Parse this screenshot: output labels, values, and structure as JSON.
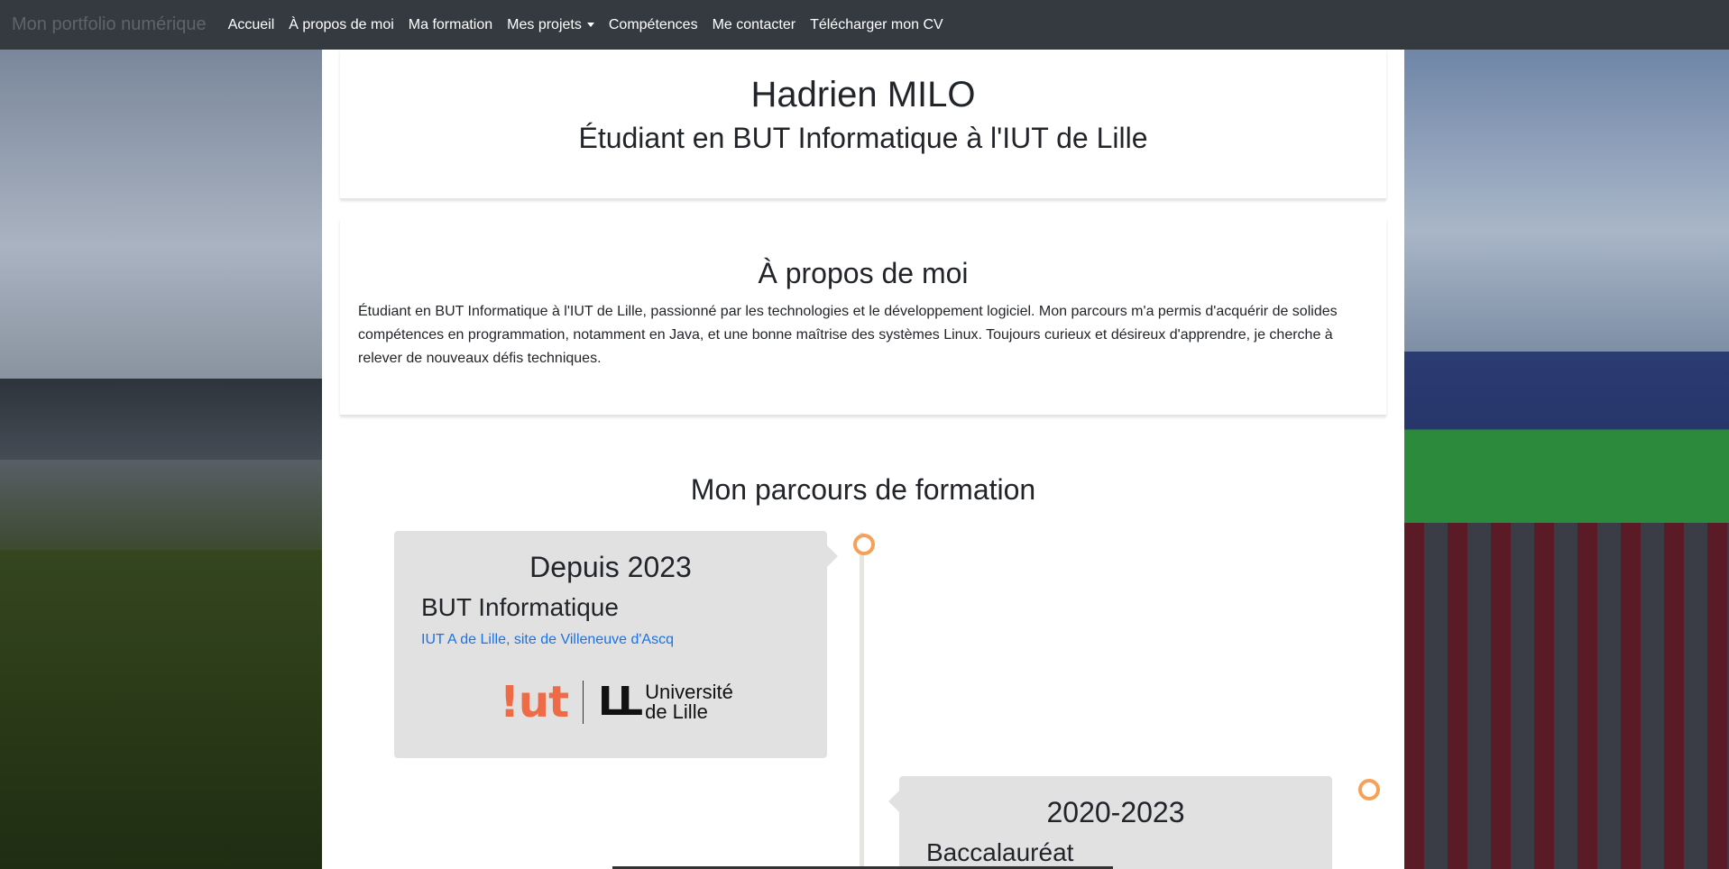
{
  "navbar": {
    "brand": "Mon portfolio numérique",
    "items": [
      {
        "label": "Accueil"
      },
      {
        "label": "À propos de moi"
      },
      {
        "label": "Ma formation"
      },
      {
        "label": "Mes projets",
        "dropdown": true
      },
      {
        "label": "Compétences"
      },
      {
        "label": "Me contacter"
      },
      {
        "label": "Télécharger mon CV"
      }
    ]
  },
  "header": {
    "name": "Hadrien MILO",
    "subtitle": "Étudiant en BUT Informatique à l'IUT de Lille"
  },
  "about": {
    "title": "À propos de moi",
    "text": "Étudiant en BUT Informatique à l'IUT de Lille, passionné par les technologies et le développement logiciel. Mon parcours m'a permis d'acquérir de solides compétences en programmation, notamment en Java, et une bonne maîtrise des systèmes Linux. Toujours curieux et désireux d'apprendre, je cherche à relever de nouveaux défis techniques."
  },
  "formation": {
    "title": "Mon parcours de formation",
    "entries": [
      {
        "year": "Depuis 2023",
        "degree": "BUT Informatique",
        "school": "IUT A de Lille, site de Villeneuve d'Ascq",
        "logo": {
          "iut": "!ut",
          "ul_mark": "LL",
          "ul_line1": "Université",
          "ul_line2": "de Lille"
        }
      },
      {
        "year": "2020-2023",
        "degree": "Baccalauréat"
      }
    ]
  },
  "colors": {
    "navbar": "#343a40",
    "timeline_dot": "#f5a15a",
    "timeline_box": "#e1e1e1",
    "link": "#1a73e8",
    "iut_logo": "#ef6b47"
  }
}
